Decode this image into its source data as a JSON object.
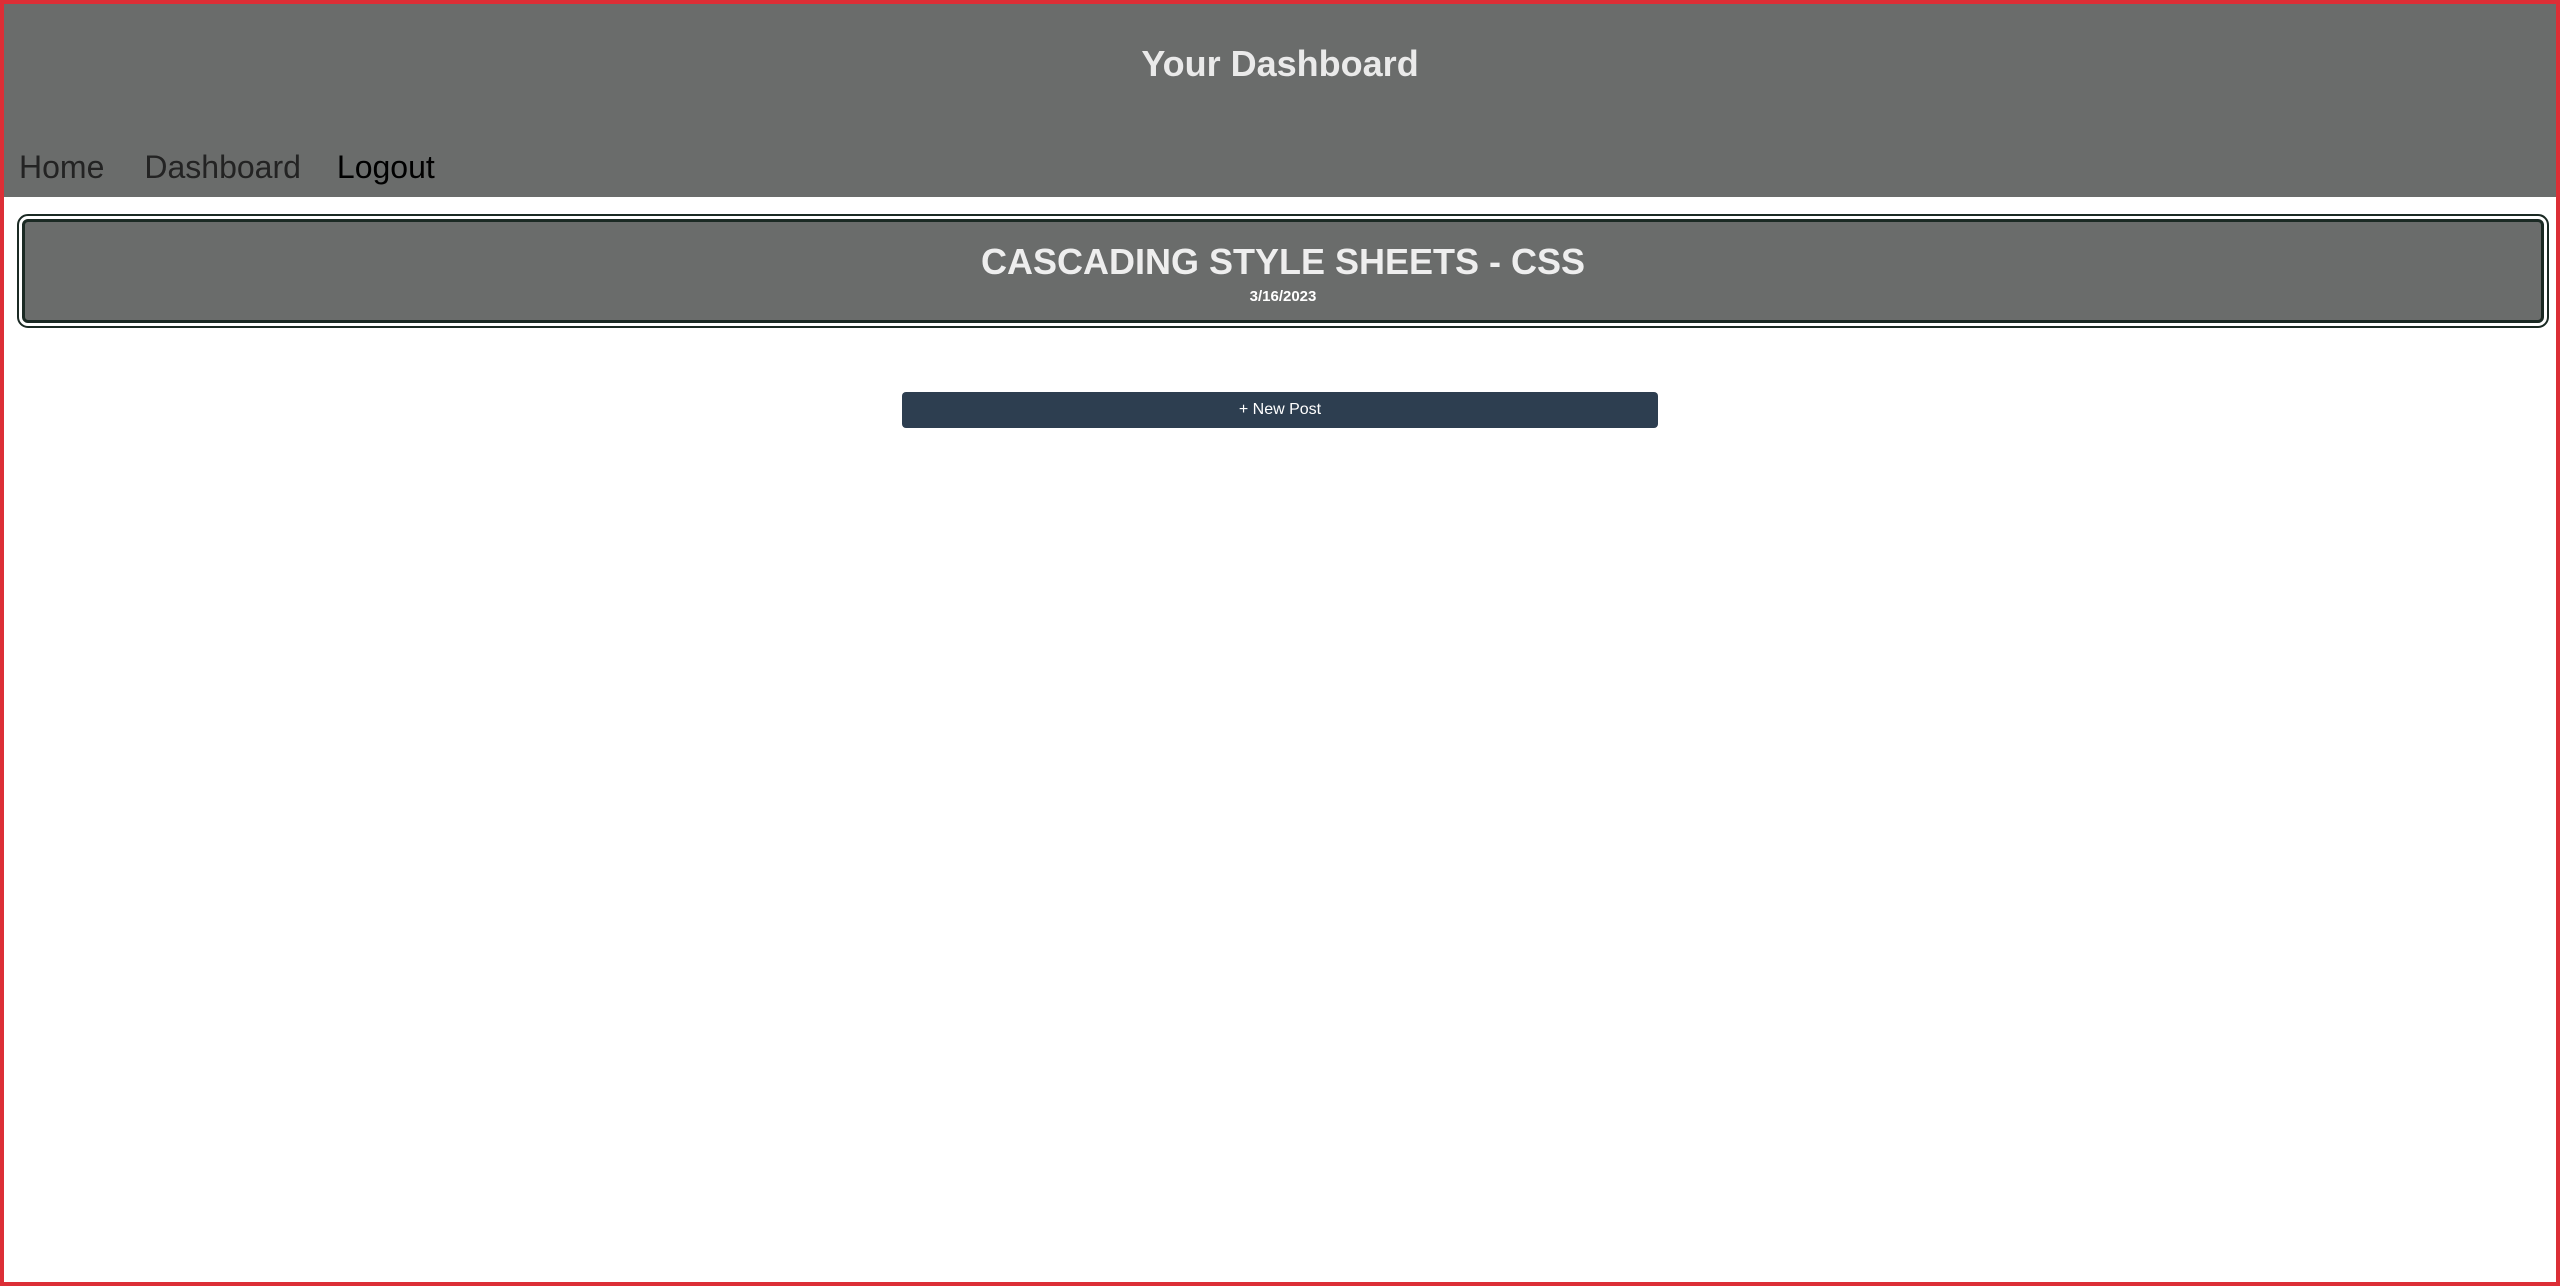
{
  "header": {
    "title": "Your Dashboard",
    "nav": {
      "home": "Home",
      "dashboard": "Dashboard",
      "logout": "Logout"
    }
  },
  "posts": [
    {
      "title": "CASCADING STYLE SHEETS - CSS",
      "date": "3/16/2023"
    }
  ],
  "actions": {
    "new_post_label": "+ New Post"
  },
  "colors": {
    "header_bg": "#6a6c6b",
    "button_bg": "#2d3e50",
    "frame_border": "#dc2e36"
  }
}
